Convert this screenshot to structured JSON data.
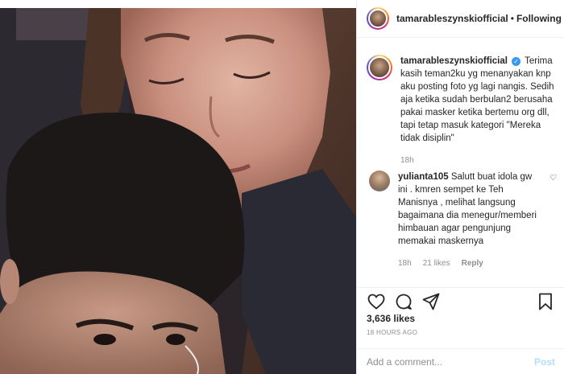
{
  "post": {
    "author": "tamarableszynskiofficial",
    "follow_status": "Following",
    "separator": "•",
    "caption": "Terima kasih teman2ku yg menanyakan knp aku posting foto yg lagi nangis. Sedih aja ketika sudah berbulan2 berusaha pakai masker ketika bertemu org dll, tapi tetap masuk kategori \"Mereka tidak disiplin\"",
    "caption_time": "18h",
    "likes": "3,636 likes",
    "posted_ago": "18 HOURS AGO"
  },
  "comments": [
    {
      "user": "yulianta105",
      "text": "Salutt buat idola gw ini . kmren sempet ke Teh Manisnya , melihat langsung bagaimana dia menegur/memberi himbauan agar pengunjung memakai maskernya",
      "time": "18h",
      "likes": "21 likes",
      "reply_label": "Reply"
    }
  ],
  "composer": {
    "placeholder": "Add a comment...",
    "post_label": "Post"
  },
  "icons": {
    "like": "heart-icon",
    "comment": "comment-icon",
    "share": "share-icon",
    "save": "bookmark-icon",
    "verified": "verified-badge-icon"
  },
  "colors": {
    "verified": "#3897f0",
    "post_button_disabled": "#b2dffc",
    "secondary_text": "#8e8e8e"
  }
}
